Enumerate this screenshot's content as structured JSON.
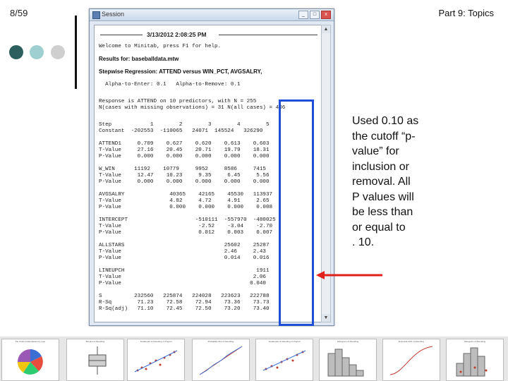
{
  "slide": {
    "page_number": "8/59",
    "part_title": "Part 9: Topics"
  },
  "session_window": {
    "title": "Session",
    "datestamp": "3/13/2012 2:08:25 PM",
    "lines": [
      {
        "text": "Welcome to Minitab, press F1 for help."
      },
      {
        "text": "Results for: baseballdata.mtw",
        "bold": true
      },
      {
        "text": "Stepwise Regression: ATTEND versus WIN_PCT, AVGSALRY,",
        "bold": true
      },
      {
        "text": "  Alpha-to-Enter: 0.1   Alpha-to-Remove: 0.1"
      },
      {
        "text": "Response is ATTEND on 10 predictors, with N = 255"
      },
      {
        "text": "N(cases with missing observations) = 31 N(all cases) = 406"
      },
      {
        "text": "Step            1        2        3        4        5"
      },
      {
        "text": "Constant  -202553  -110065   24071  145524   326290"
      },
      {
        "text": "ATTEND1     0.709    0.627    0.620    0.613    0.603"
      },
      {
        "text": "T-Value     27.16    20.45    20.71    19.79    18.31"
      },
      {
        "text": "P-Value     0.000    0.000    0.000    0.000    0.000"
      },
      {
        "text": "W_WIN      11192    10779     9952     8586     7415"
      },
      {
        "text": "T-Value     12.47    10.23     9.35     6.45     5.56"
      },
      {
        "text": "P-Value     0.000    0.000    0.000    0.000    0.000"
      },
      {
        "text": "AVGSALRY              40365    42165    45530   113937"
      },
      {
        "text": "T-Value               4.82     4.72     4.91     2.65"
      },
      {
        "text": "P-Value               0.000    0.000    0.000    0.008"
      },
      {
        "text": "INTERCEPT                     -510111  -557970  -480025"
      },
      {
        "text": "T-Value                        -2.52    -3.04    -2.70"
      },
      {
        "text": "P-Value                        0.012    0.003    0.007"
      },
      {
        "text": "ALLSTARS                               25602    25287"
      },
      {
        "text": "T-Value                                2.46     2.43"
      },
      {
        "text": "P-Value                                0.014    0.016"
      },
      {
        "text": "LINEUPCH                                         1911"
      },
      {
        "text": "T-Value                                         2.06"
      },
      {
        "text": "P-Value                                        0.040"
      },
      {
        "text": "S          232560   225874   224028   223623   222788"
      },
      {
        "text": "R-Sq        71.23    72.58    72.94    73.36    73.73"
      },
      {
        "text": "R-Sq(adj)   71.10    72.45    72.50    73.20    73.40"
      }
    ]
  },
  "callout": {
    "lines": [
      "Used 0.10 as",
      "the cutoff “p-",
      "value” for",
      "inclusion or",
      "removal.  All",
      "P values will",
      "be less than",
      "or equal to",
      ". 10."
    ]
  },
  "thumbnails": [
    {
      "title": "Pie Chart of Attendance by type"
    },
    {
      "title": "Boxplot of Attending"
    },
    {
      "title": "Scatterplot of Attending vs Payroll"
    },
    {
      "title": "Probability Plot of Attending"
    },
    {
      "title": "Scatterplot of Attending vs Payroll"
    },
    {
      "title": "Histogram of Attending"
    },
    {
      "title": "Empirical CDF of Attending"
    },
    {
      "title": "Histogram of Attending"
    },
    {
      "title": "Scatterplot of Attending"
    }
  ],
  "colors": {
    "highlight": "#1f4fd6",
    "arrow": "#e0201b"
  }
}
